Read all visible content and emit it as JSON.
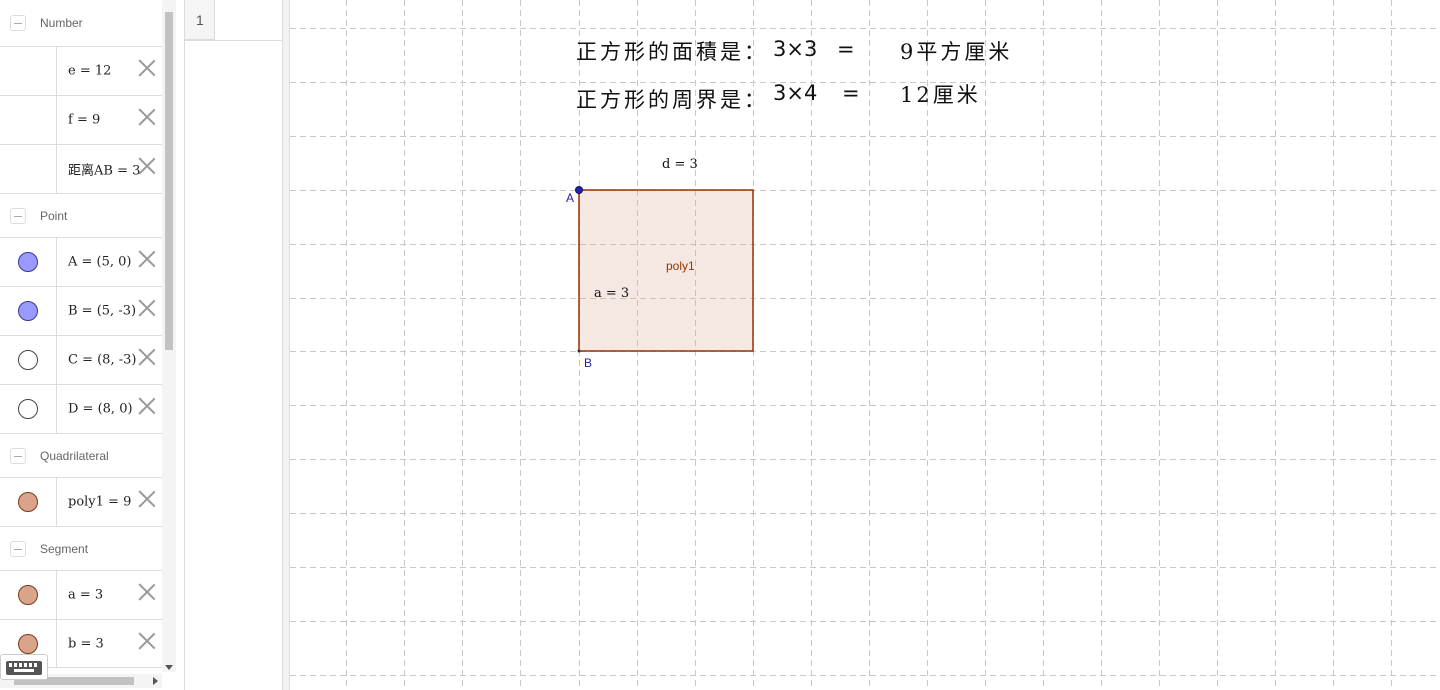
{
  "algebra": {
    "categories": {
      "number": "Number",
      "point": "Point",
      "quadrilateral": "Quadrilateral",
      "segment": "Segment"
    },
    "numbers": [
      "e = 12",
      "f = 9",
      "距离AB = 3"
    ],
    "points": [
      "A = (5, 0)",
      "B = (5, -3)",
      "C = (8, -3)",
      "D = (8, 0)"
    ],
    "quadrilaterals": [
      "poly1 = 9"
    ],
    "segments": [
      "a = 3",
      "b = 3"
    ]
  },
  "colors": {
    "point_fill_filled": "#9999ff",
    "point_fill_empty": "#ffffff",
    "poly_fill": "#d9a48a",
    "poly_stroke": "#993300",
    "point_label": "#1f1fa0"
  },
  "spreadsheet": {
    "row_label": "1"
  },
  "graphics": {
    "area_line": {
      "label": "正方形的面積是：",
      "expr": "3×3",
      "eq": "=",
      "result": "9平方厘米"
    },
    "perimeter_line": {
      "label": "正方形的周界是：",
      "expr": "3×4",
      "eq": "=",
      "result": "12厘米"
    },
    "segment_d_label": "d = 3",
    "segment_a_label": "a = 3",
    "poly_label": "poly1",
    "point_a_label": "A",
    "point_b_label": "B"
  },
  "icons": {
    "keyboard": "keyboard-icon",
    "delete": "close-icon",
    "collapse": "collapse-icon"
  }
}
